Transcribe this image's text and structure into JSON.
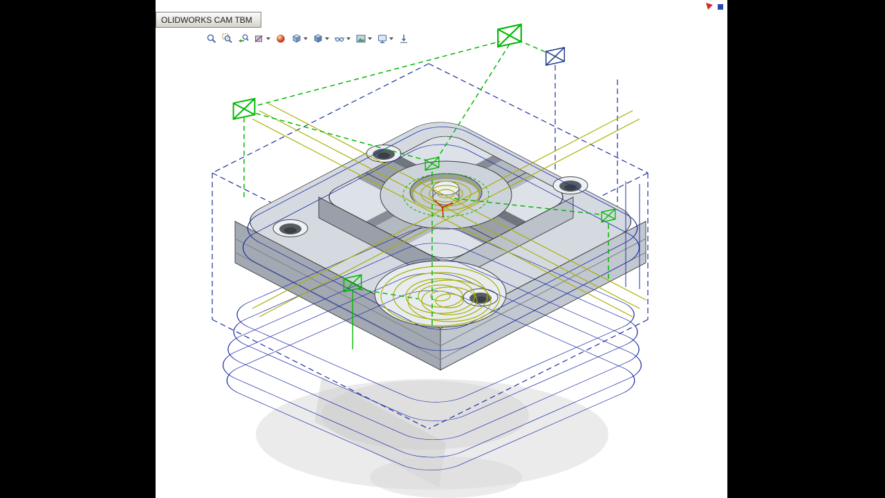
{
  "window": {
    "tab_label": "OLIDWORKS CAM TBM"
  },
  "toolbar": {
    "icons": [
      "zoom-to-fit",
      "zoom-to-area",
      "previous-view",
      "section-view",
      "edit-appearance",
      "view-orientation",
      "display-style",
      "hide-show-items",
      "apply-scene",
      "view-settings",
      "3d-view-arrow"
    ]
  },
  "viewport": {
    "content": "isometric machined block with cross slot, center boss, corner counterbore holes, CAM toolpaths",
    "colors": {
      "rapid_move_green": "#00b800",
      "cut_toolpath_olive": "#a8b000",
      "wireframe_blue": "#1f2fa6",
      "stock_box_navy": "#1c2f9e",
      "marker_navy": "#223a8c",
      "origin_red": "#cc2a00",
      "part_gray": "#ccd2da",
      "background": "#ffffff",
      "letterbox": "#000000"
    }
  }
}
